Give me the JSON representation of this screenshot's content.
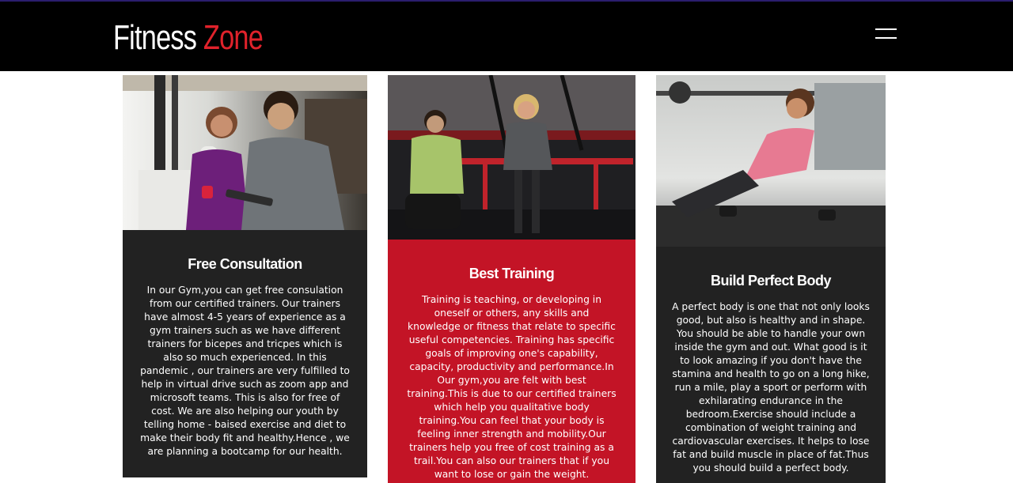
{
  "header": {
    "brand_part1": "Fitness ",
    "brand_part2": "Zone",
    "brand_accent_color": "#e0222b",
    "menu_icon": "hamburger-menu-icon"
  },
  "cards": [
    {
      "photo_icon": "trainer-consultation-photo",
      "title": "Free Consultation",
      "text": "In our Gym,you can get free consulation from our certified trainers. Our trainers have almost 4-5 years of experience as a gym trainers such as we have different trainers for bicepes and tricpes which is also so much experienced. In this pandemic , our trainers are very fulfilled to help in virtual drive such as zoom app and microsoft teams. This is also for free of cost. We are also helping our youth by telling home - baised exercise and diet to make their body fit and healthy.Hence , we are planning a bootcamp for our health.",
      "panel_color": "#222222"
    },
    {
      "photo_icon": "suspension-training-photo",
      "title": "Best Training",
      "text": "Training is teaching, or developing in oneself or others, any skills and knowledge or fitness that relate to specific useful competencies. Training has specific goals of improving one's capability, capacity, productivity and performance.In Our gym,you are felt with best training.This is due to our certified trainers which help you qualitative body training.You can feel that your body is feeling inner strength and mobility.Our trainers help you free of cost training as a trail.You can also our trainers that if you want to lose or gain the weight.",
      "panel_color": "#c31426"
    },
    {
      "photo_icon": "pushup-woman-photo",
      "title": "Build Perfect Body",
      "text": "A perfect body is one that not only looks good, but also is healthy and in shape. You should be able to handle your own inside the gym and out. What good is it to look amazing if you don't have the stamina and health to go on a long hike, run a mile, play a sport or perform with exhilarating endurance in the bedroom.Exercise should include a combination of weight training and cardiovascular exercises. It helps to lose fat and build muscle in place of fat.Thus you should build a perfect body.",
      "panel_color": "#222222"
    }
  ]
}
